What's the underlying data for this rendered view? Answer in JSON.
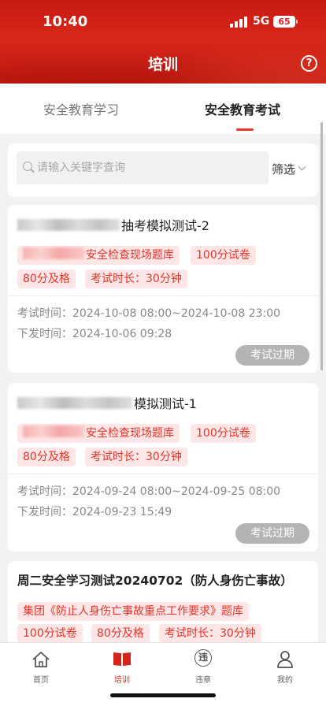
{
  "status_bar": {
    "time": "10:40",
    "network": "5G",
    "battery": "65"
  },
  "header": {
    "title": "培训",
    "help_icon": "question-circle-icon"
  },
  "tabs": [
    {
      "label": "安全教育学习",
      "active": false
    },
    {
      "label": "安全教育考试",
      "active": true
    }
  ],
  "search": {
    "placeholder": "请输入关键字查询",
    "value": "",
    "filter_label": "筛选"
  },
  "exams": [
    {
      "title_suffix": "抽考模拟测试-2",
      "tag_bank_suffix": "安全检查现场题库",
      "tags": [
        "100分试卷",
        "80分及格",
        "考试时长：30分钟"
      ],
      "exam_time_label": "考试时间：",
      "exam_time": "2024-10-08 08:00~2024-10-08 23:00",
      "issue_time_label": "下发时间：",
      "issue_time": "2024-10-06 09:28",
      "status": "考试过期"
    },
    {
      "title_suffix": "模拟测试-1",
      "tag_bank_suffix": "安全检查现场题库",
      "tags": [
        "100分试卷",
        "80分及格",
        "考试时长：30分钟"
      ],
      "exam_time_label": "考试时间：",
      "exam_time": "2024-09-24 08:00~2024-09-25 08:00",
      "issue_time_label": "下发时间：",
      "issue_time": "2024-09-23 15:49",
      "status": "考试过期"
    },
    {
      "title": "周二安全学习测试20240702（防人身伤亡事故）",
      "tag_bank": "集团《防止人身伤亡事故重点工作要求》题库",
      "tags": [
        "100分试卷",
        "80分及格",
        "考试时长：30分钟"
      ]
    }
  ],
  "bottom_nav": [
    {
      "label": "首页",
      "icon": "home-icon",
      "active": false
    },
    {
      "label": "培训",
      "icon": "book-icon",
      "active": true
    },
    {
      "label": "违章",
      "icon": "violation-icon",
      "icon_glyph": "违",
      "active": false
    },
    {
      "label": "我的",
      "icon": "user-icon",
      "active": false
    }
  ],
  "colors": {
    "brand_red": "#d8261a",
    "tag_bg": "#fde6e5",
    "tag_text": "#e5342a",
    "expired_btn": "#b4b4b4"
  }
}
